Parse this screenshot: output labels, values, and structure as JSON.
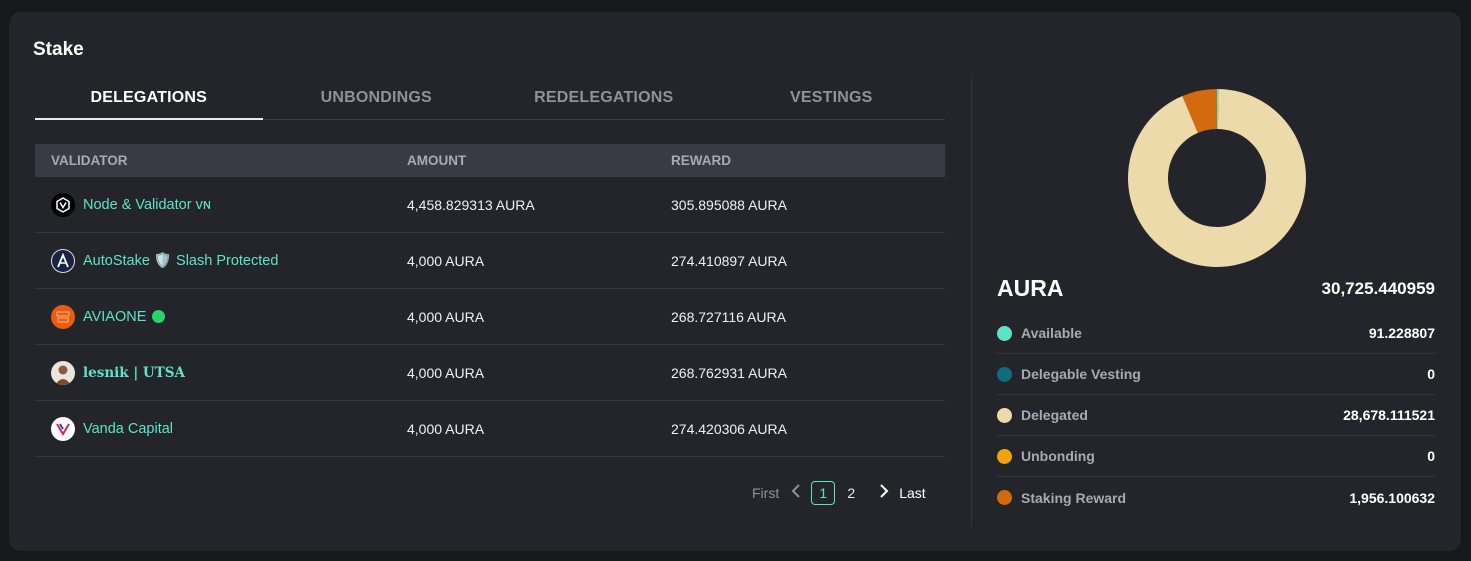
{
  "card": {
    "title": "Stake"
  },
  "tabs": [
    {
      "label": "DELEGATIONS",
      "active": true
    },
    {
      "label": "UNBONDINGS",
      "active": false
    },
    {
      "label": "REDELEGATIONS",
      "active": false
    },
    {
      "label": "VESTINGS",
      "active": false
    }
  ],
  "table": {
    "headers": [
      "VALIDATOR",
      "AMOUNT",
      "REWARD"
    ],
    "rows": [
      {
        "validator": "Node & Validator ᴠɴ",
        "amount": "4,458.829313 AURA",
        "reward": "305.895088 AURA",
        "icon": "node-validator-logo-icon"
      },
      {
        "validator": "AutoStake 🛡️ Slash Protected",
        "amount": "4,000 AURA",
        "reward": "274.410897 AURA",
        "icon": "autostake-logo-icon"
      },
      {
        "validator": "AVIAONE",
        "amount": "4,000 AURA",
        "reward": "268.727116 AURA",
        "icon": "aviaone-logo-icon"
      },
      {
        "validator": "lesnik | UTSA",
        "amount": "4,000 AURA",
        "reward": "268.762931 AURA",
        "icon": "lesnik-avatar-icon"
      },
      {
        "validator": "Vanda Capital",
        "amount": "4,000 AURA",
        "reward": "274.420306 AURA",
        "icon": "vanda-capital-logo-icon"
      }
    ]
  },
  "pagination": {
    "first": "First",
    "pages": [
      "1",
      "2"
    ],
    "current": "1",
    "last": "Last"
  },
  "summary": {
    "token": "AURA",
    "total": "30,725.440959",
    "legend": [
      {
        "label": "Available",
        "value": "91.228807",
        "color": "#5ee3c8"
      },
      {
        "label": "Delegable Vesting",
        "value": "0",
        "color": "#0f6b7e"
      },
      {
        "label": "Delegated",
        "value": "28,678.111521",
        "color": "#ecdaaa"
      },
      {
        "label": "Unbonding",
        "value": "0",
        "color": "#f0a30a"
      },
      {
        "label": "Staking Reward",
        "value": "1,956.100632",
        "color": "#d46a0e"
      }
    ]
  },
  "chart_data": {
    "type": "pie",
    "categories": [
      "Available",
      "Delegable Vesting",
      "Delegated",
      "Unbonding",
      "Staking Reward"
    ],
    "values": [
      91.228807,
      0,
      28678.111521,
      0,
      1956.100632
    ],
    "colors": [
      "#5ee3c8",
      "#0f6b7e",
      "#ecdaaa",
      "#f0a30a",
      "#d46a0e"
    ]
  }
}
